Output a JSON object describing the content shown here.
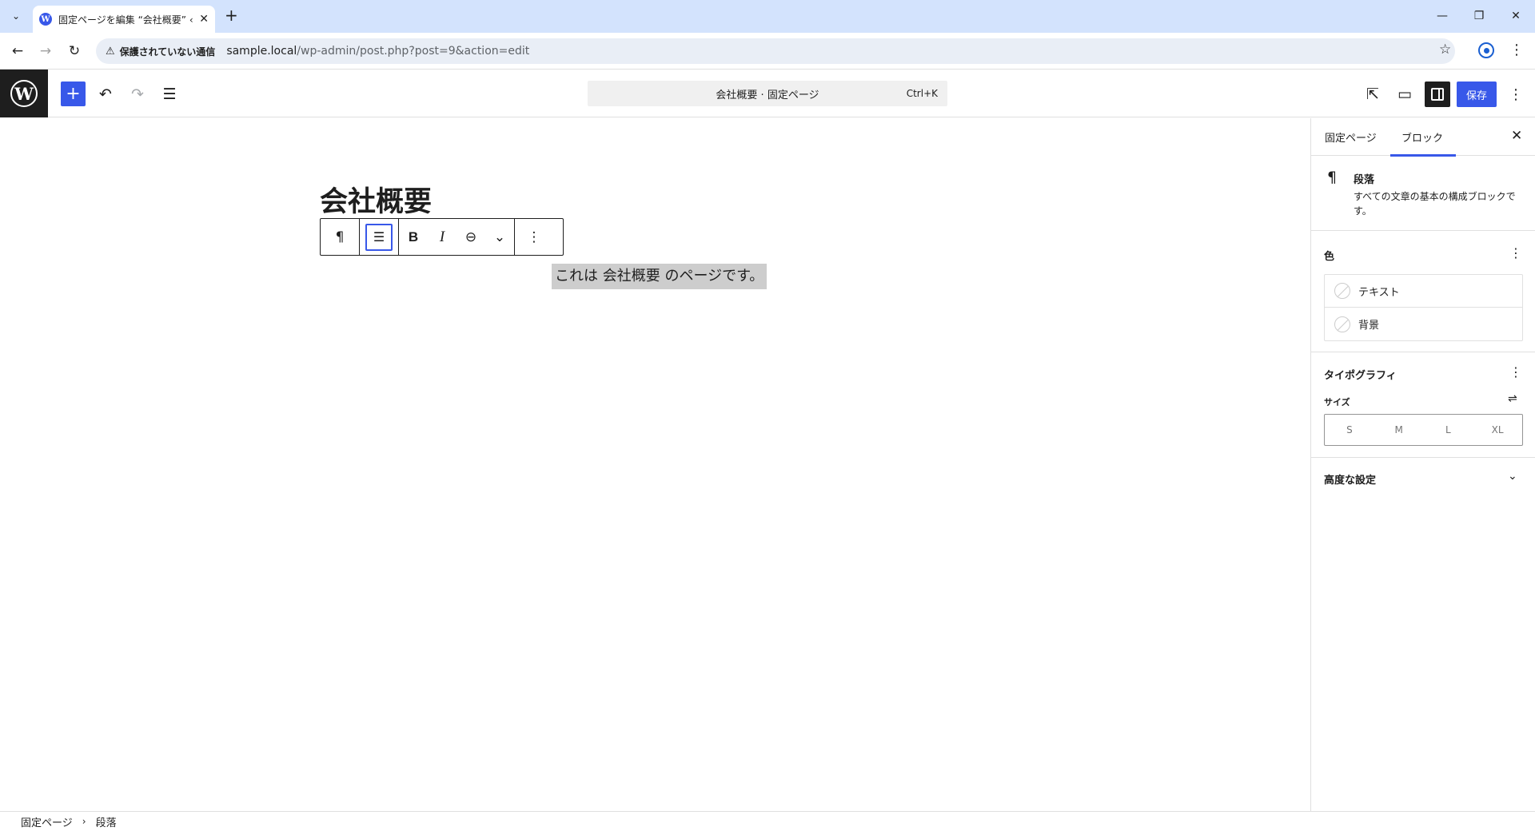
{
  "browser": {
    "tab_title": "固定ページを編集 “会社概要” ‹ サ",
    "url_warning": "保護されていない通信",
    "url_host": "sample.local",
    "url_path": "/wp-admin/post.php?post=9&action=edit"
  },
  "header": {
    "command_title": "会社概要 · 固定ページ",
    "command_shortcut": "Ctrl+K",
    "save_label": "保存"
  },
  "editor": {
    "post_title": "会社概要",
    "paragraph_text": "これは 会社概要 のページです。"
  },
  "sidebar": {
    "tabs": [
      "固定ページ",
      "ブロック"
    ],
    "active_tab": "ブロック",
    "block_card": {
      "title": "段落",
      "description": "すべての文章の基本の構成ブロックです。"
    },
    "color_panel": {
      "title": "色",
      "items": [
        "テキスト",
        "背景"
      ]
    },
    "typography_panel": {
      "title": "タイポグラフィ",
      "size_label": "サイズ",
      "sizes": [
        "S",
        "M",
        "L",
        "XL"
      ]
    },
    "advanced_panel": {
      "title": "高度な設定"
    }
  },
  "footer": {
    "breadcrumbs": [
      "固定ページ",
      "段落"
    ]
  },
  "colors": {
    "accent": "#3858e9",
    "tabstrip": "#d3e3fd",
    "dark": "#1e1e1e",
    "selection": "#cdcdcd"
  },
  "icons": {
    "inserter": "plus-icon",
    "undo": "undo-icon",
    "redo": "redo-icon",
    "document_overview": "list-view-icon",
    "view_post": "external-link-icon",
    "preview": "desktop-icon",
    "settings": "sidebar-icon"
  }
}
